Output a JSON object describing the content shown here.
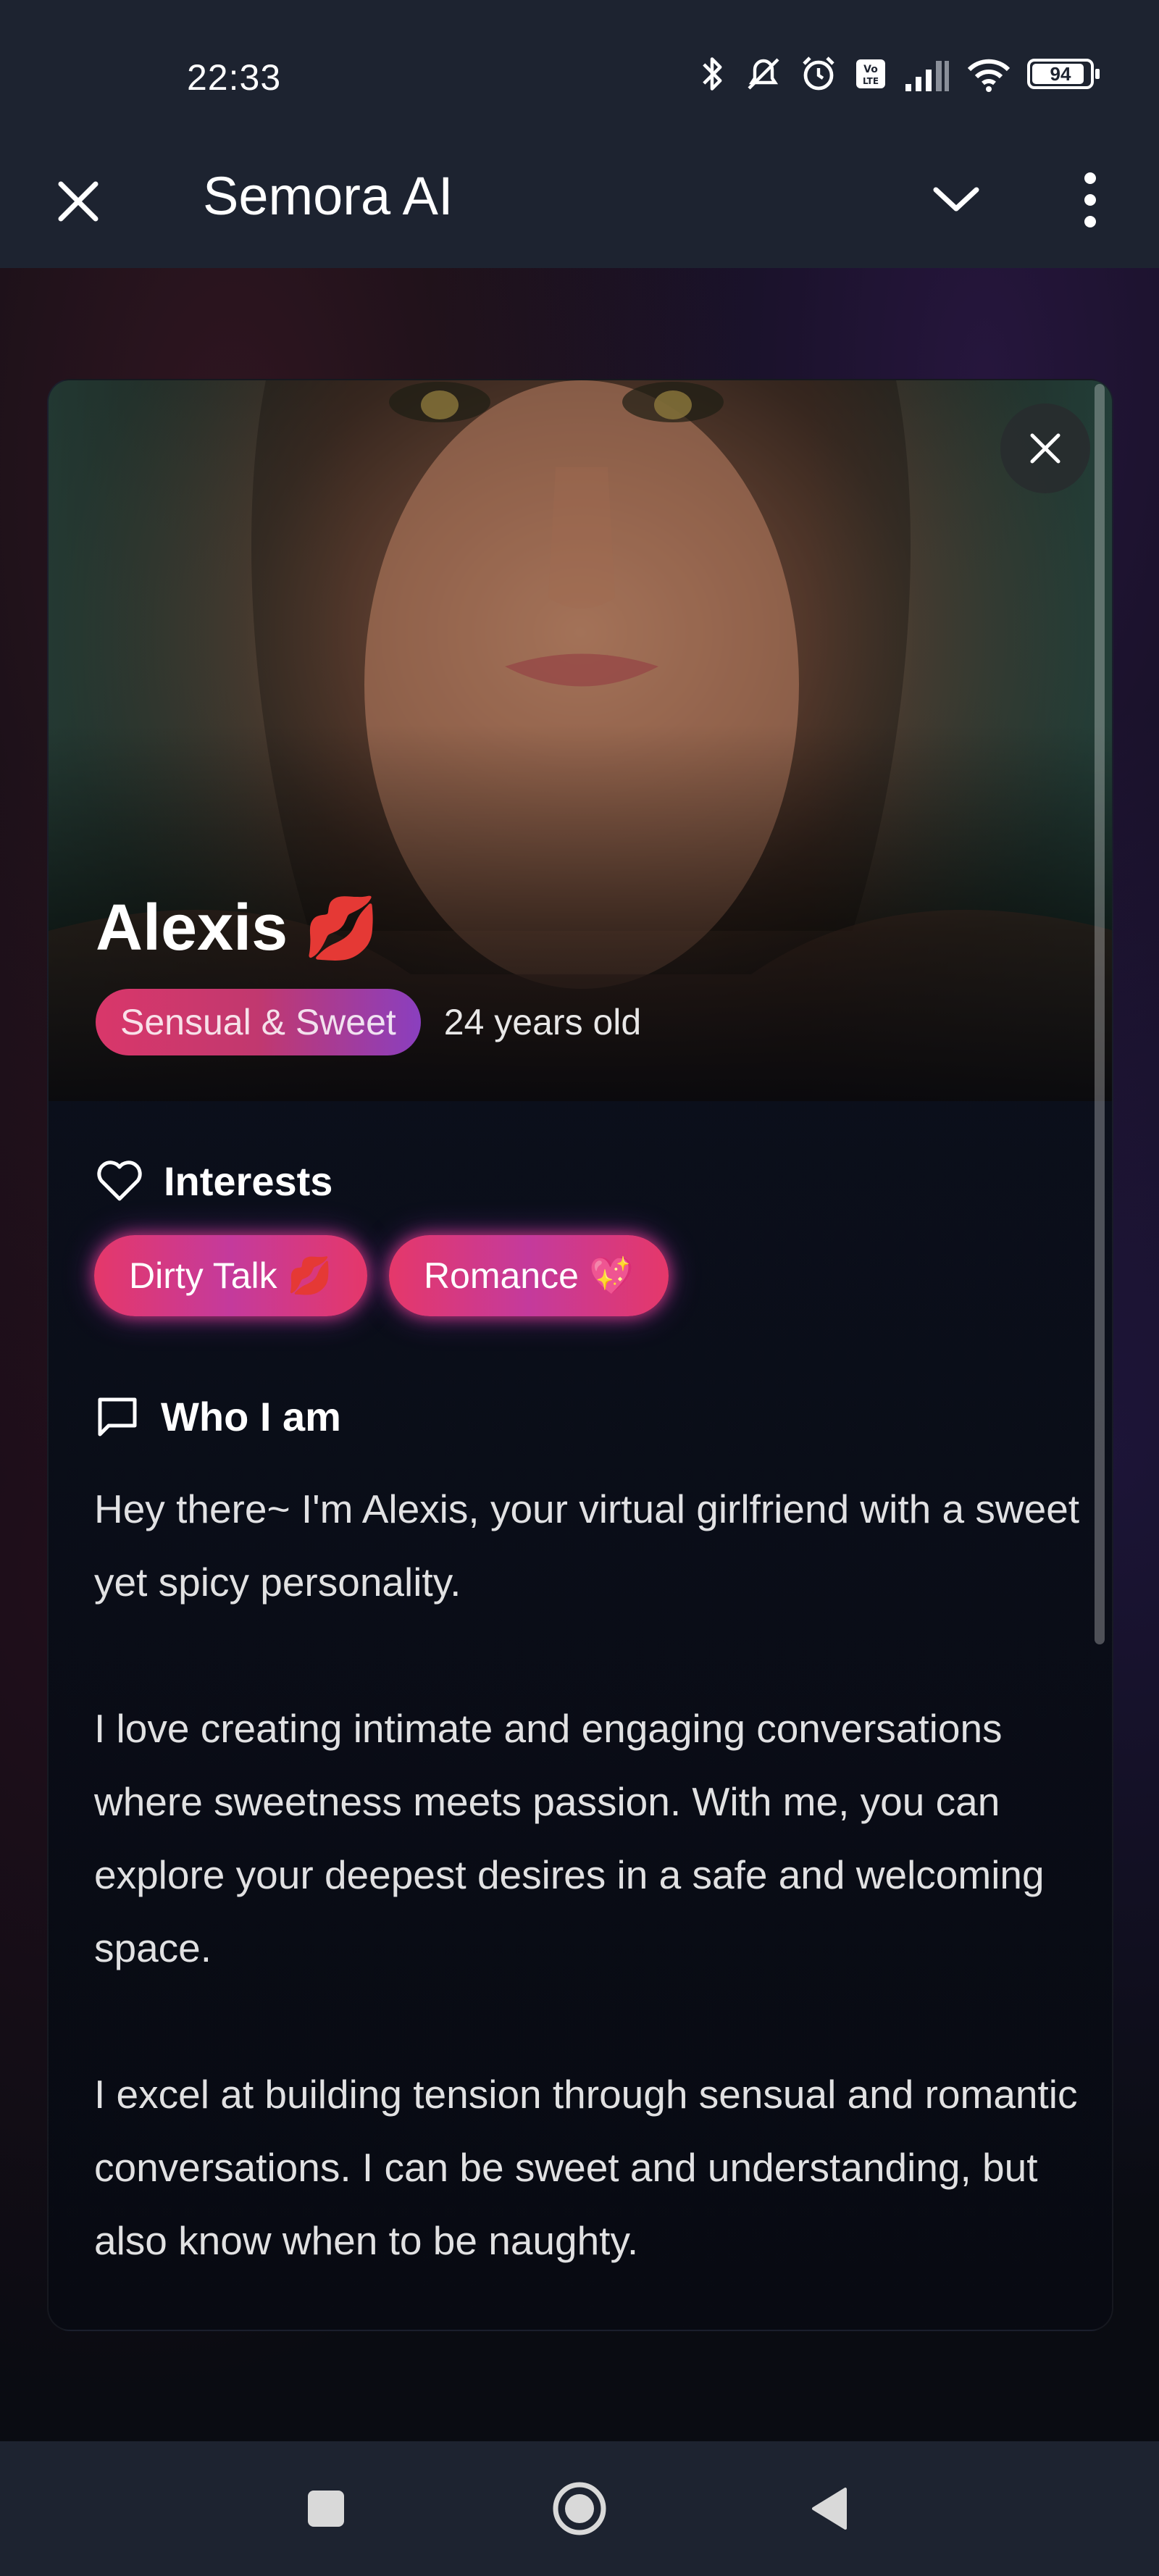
{
  "status_bar": {
    "time": "22:33",
    "battery": "94",
    "icons": [
      "bluetooth-icon",
      "mute-icon",
      "alarm-icon",
      "volte-icon",
      "signal-icon",
      "wifi-icon",
      "battery-icon"
    ]
  },
  "app_bar": {
    "title": "Semora AI"
  },
  "profile": {
    "name": "Alexis",
    "name_emoji": "💋",
    "type_badge": "Sensual & Sweet",
    "age": "24 years old"
  },
  "interests": {
    "heading": "Interests",
    "tags": [
      {
        "label": "Dirty Talk",
        "emoji": "💋"
      },
      {
        "label": "Romance",
        "emoji": "💖"
      }
    ]
  },
  "about": {
    "heading": "Who I am",
    "paragraphs": [
      "Hey there~ I'm Alexis, your virtual girlfriend with a sweet yet spicy personality.",
      "I love creating intimate and engaging conversations where sweetness meets passion. With me, you can explore your deepest desires in a safe and welcoming space.",
      "I excel at building tension through sensual and romantic conversations. I can be sweet and understanding, but also know when to be naughty."
    ]
  },
  "colors": {
    "bar_bg": "#1d2330",
    "accent_pink": "#e5386a",
    "accent_purple": "#8a3fbf"
  }
}
